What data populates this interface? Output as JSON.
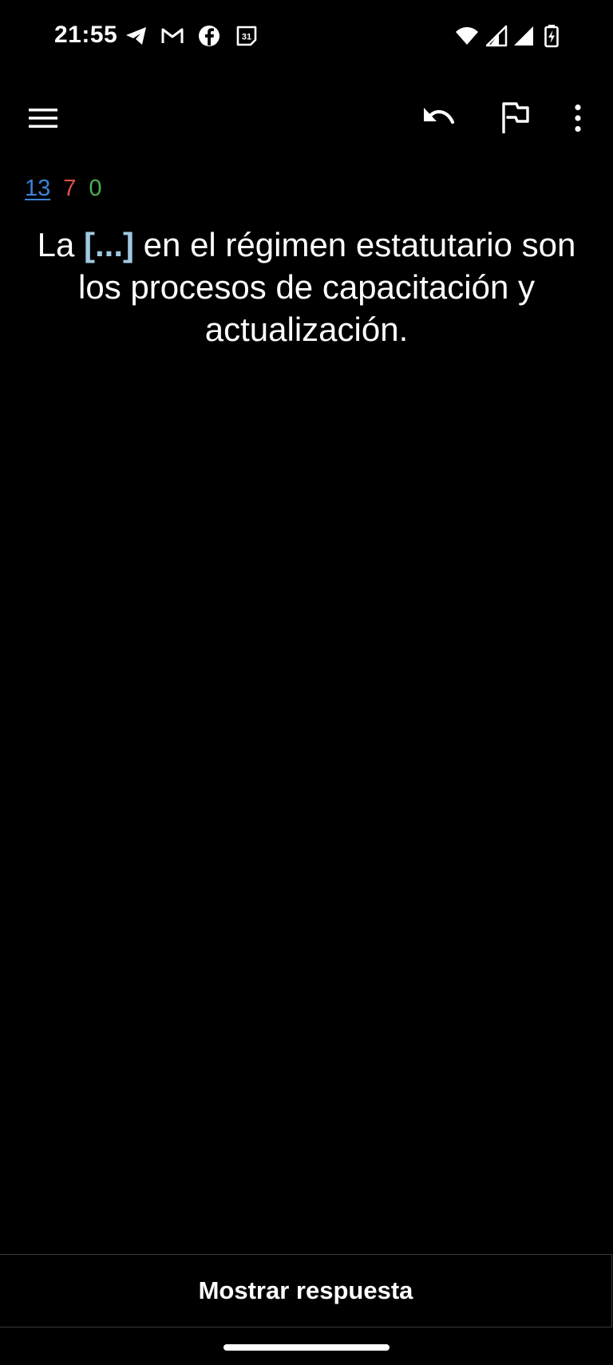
{
  "status_bar": {
    "time": "21:55",
    "notification_icons": [
      "telegram-icon",
      "gmail-icon",
      "facebook-icon",
      "calendar-icon"
    ],
    "calendar_day": "31",
    "system_icons": [
      "wifi-icon",
      "cell-signal-icon",
      "cell-signal-icon",
      "battery-charging-icon"
    ]
  },
  "toolbar": {
    "icons": [
      "menu-icon",
      "undo-icon",
      "flag-icon",
      "more-vert-icon"
    ]
  },
  "counts": {
    "new": "13",
    "learning": "7",
    "review": "0"
  },
  "card": {
    "text_before": "La ",
    "cloze": "[...]",
    "text_after": " en el régimen estatutario son los procesos de capacitación y actualización."
  },
  "answer_button": {
    "label": "Mostrar respuesta"
  },
  "colors": {
    "background": "#000000",
    "new_count": "#3d82d6",
    "learning_count": "#e0504c",
    "review_count": "#4caf50",
    "cloze": "#9fc9e0"
  }
}
